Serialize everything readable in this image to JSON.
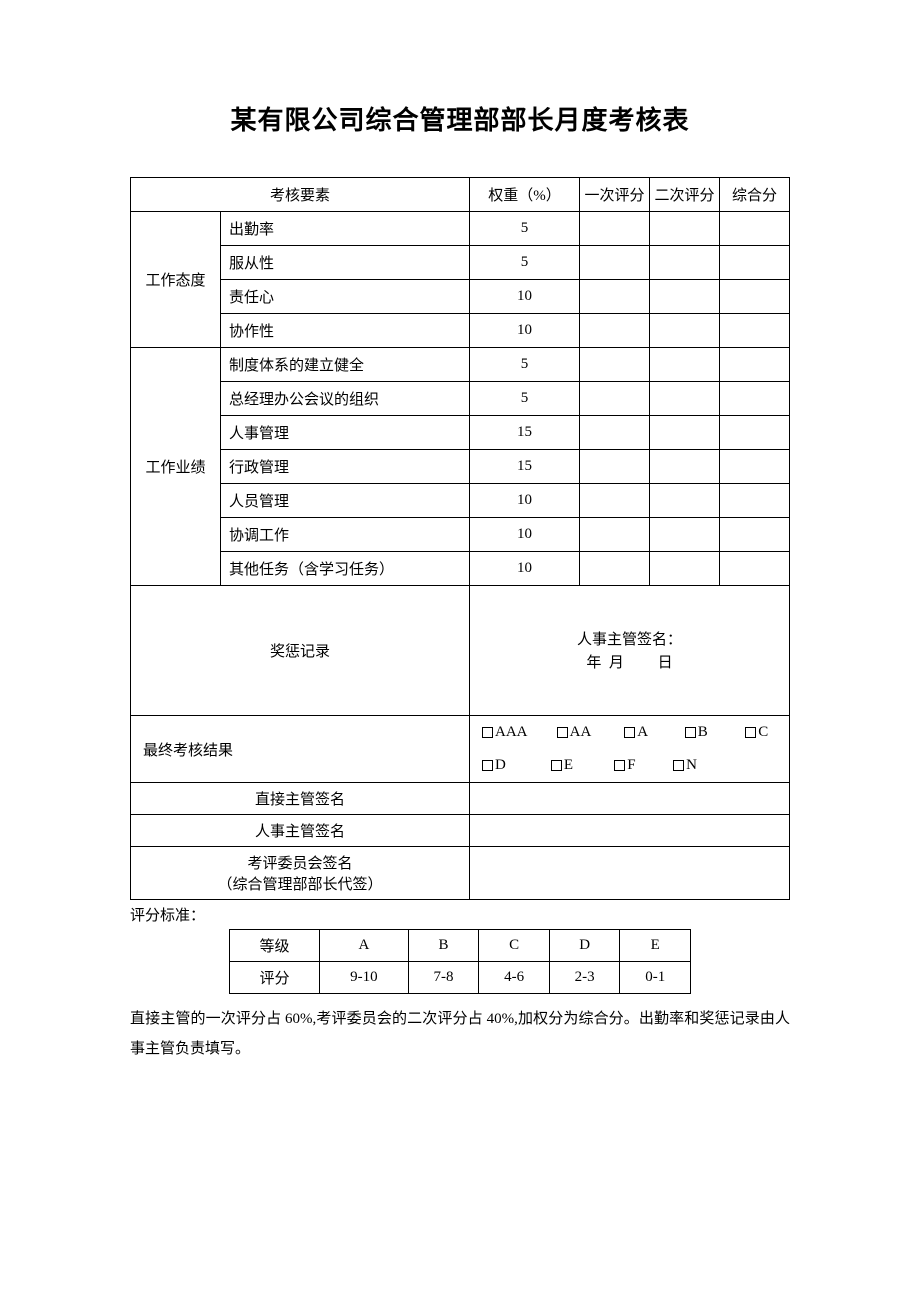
{
  "title": "某有限公司综合管理部部长月度考核表",
  "headers": {
    "elements": "考核要素",
    "weight": "权重（%）",
    "score1": "一次评分",
    "score2": "二次评分",
    "total": "综合分"
  },
  "cat1": {
    "name": "工作态度",
    "items": [
      {
        "label": "出勤率",
        "weight": "5"
      },
      {
        "label": "服从性",
        "weight": "5"
      },
      {
        "label": "责任心",
        "weight": "10"
      },
      {
        "label": "协作性",
        "weight": "10"
      }
    ]
  },
  "cat2": {
    "name": "工作业绩",
    "items": [
      {
        "label": "制度体系的建立健全",
        "weight": "5"
      },
      {
        "label": "总经理办公会议的组织",
        "weight": "5"
      },
      {
        "label": "人事管理",
        "weight": "15"
      },
      {
        "label": "行政管理",
        "weight": "15"
      },
      {
        "label": "人员管理",
        "weight": "10"
      },
      {
        "label": "协调工作",
        "weight": "10"
      },
      {
        "label": "其他任务（含学习任务）",
        "weight": "10"
      }
    ]
  },
  "reward": {
    "label": "奖惩记录",
    "sig": "人事主管签名：",
    "date_y": "年",
    "date_m": "月",
    "date_d": "日"
  },
  "result": {
    "label": "最终考核结果",
    "opts1": [
      "AAA",
      "AA",
      "A",
      "B",
      "C"
    ],
    "opts2": [
      "D",
      "E",
      "F",
      "N"
    ]
  },
  "sigs": {
    "direct": "直接主管签名",
    "hr": "人事主管签名",
    "committee": "考评委员会签名",
    "committee_sub": "（综合管理部部长代签）"
  },
  "note_label": "评分标准：",
  "grades": {
    "row_label1": "等级",
    "row_label2": "评分",
    "cols": [
      "A",
      "B",
      "C",
      "D",
      "E"
    ],
    "scores": [
      "9-10",
      "7-8",
      "4-6",
      "2-3",
      "0-1"
    ]
  },
  "desc": "直接主管的一次评分占 60%,考评委员会的二次评分占 40%,加权分为综合分。出勤率和奖惩记录由人事主管负责填写。"
}
